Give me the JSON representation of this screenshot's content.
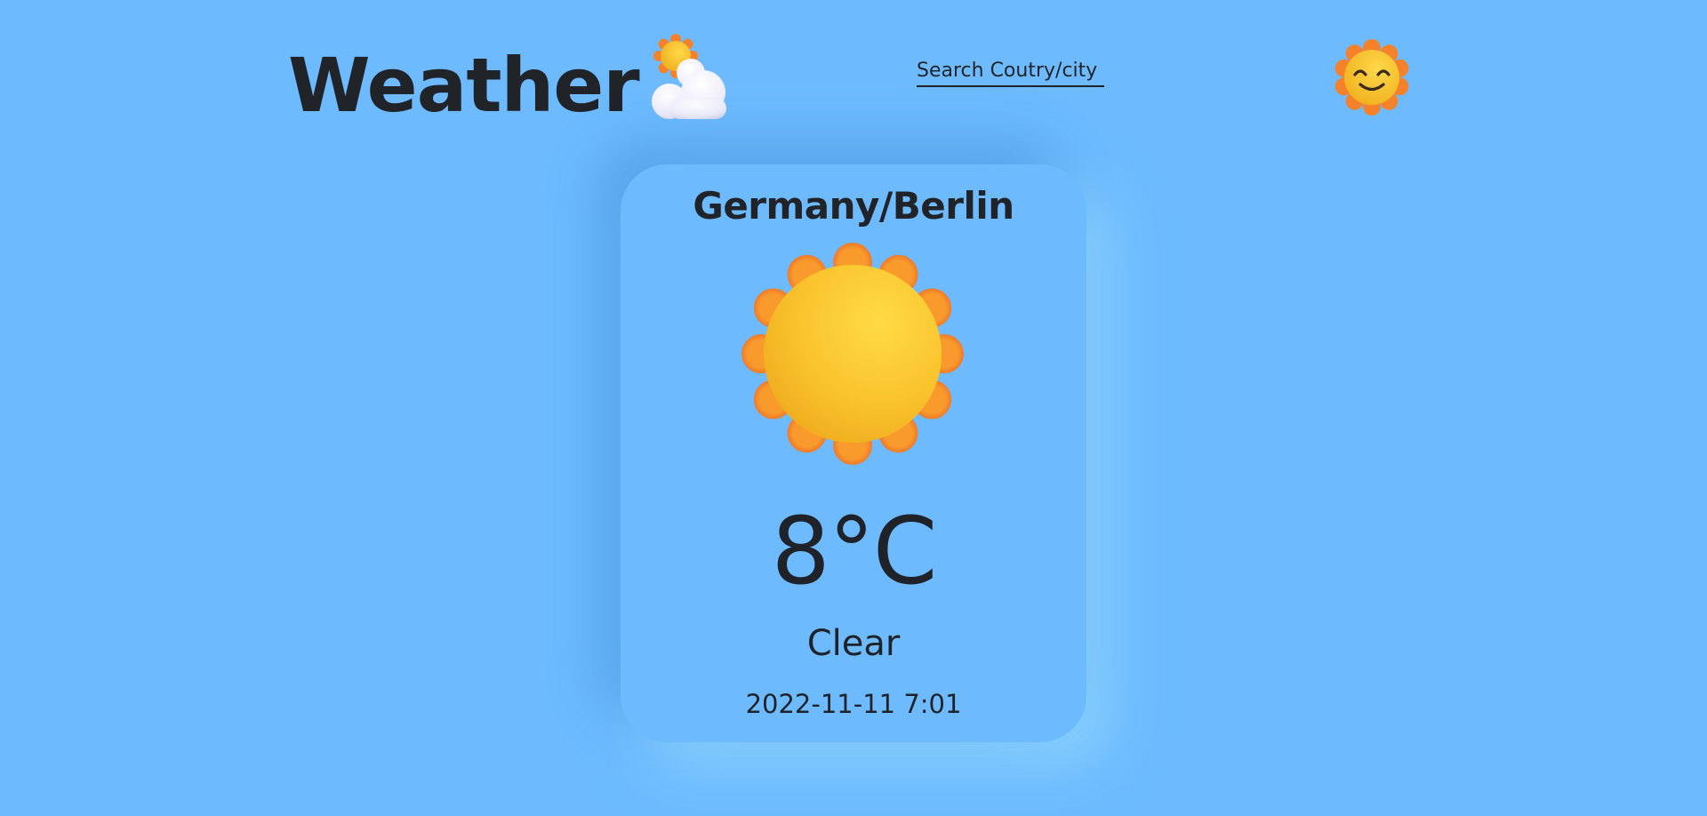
{
  "header": {
    "title": "Weather",
    "logo_icon": "sun-behind-cloud-icon",
    "search_placeholder": "Search Coutry/city",
    "avatar_icon": "smiling-sun-icon"
  },
  "weather_card": {
    "location": "Germany/Berlin",
    "condition_icon": "sun-icon",
    "temperature": "8°C",
    "condition": "Clear",
    "datetime": "2022-11-11 7:01"
  },
  "colors": {
    "background": "#6dbbfe",
    "text": "#1f2329",
    "sun_core": "#fbc02d",
    "sun_petals": "#f5822b"
  }
}
